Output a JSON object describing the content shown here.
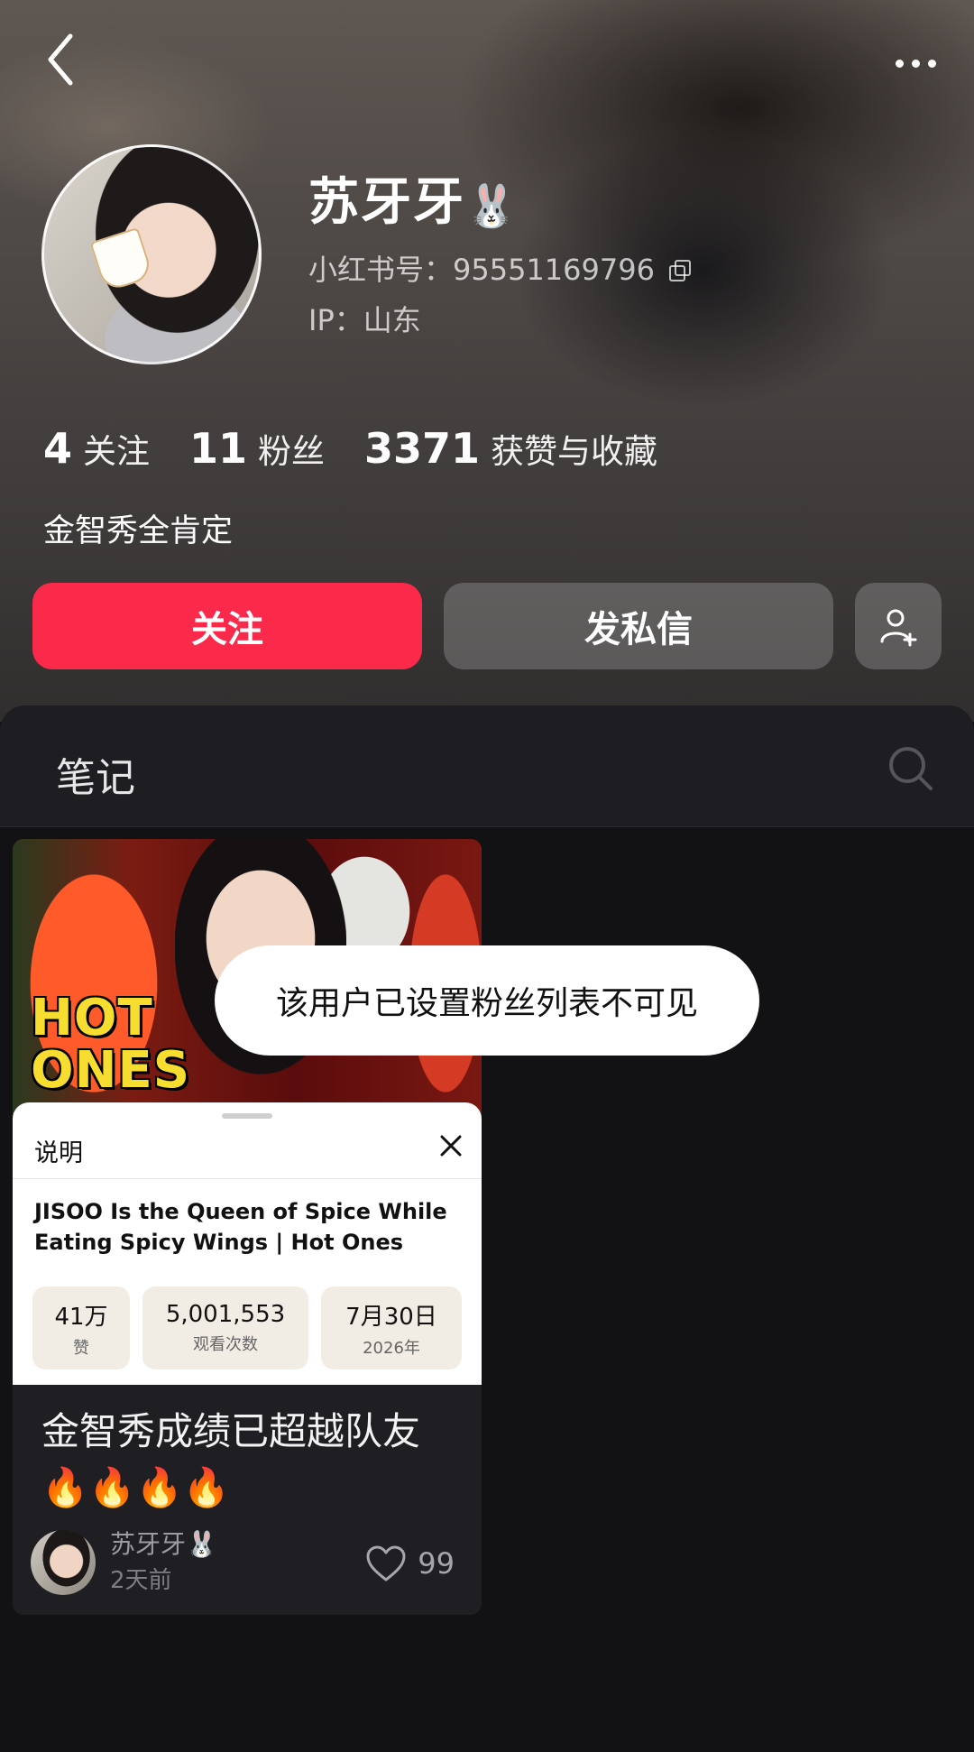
{
  "profile": {
    "name": "苏牙牙",
    "name_emoji": "🐰",
    "id_label": "小红书号：95551169796",
    "ip_label": "IP：山东",
    "bio": "金智秀全肯定"
  },
  "stats": [
    {
      "num": "4",
      "label": "关注"
    },
    {
      "num": "11",
      "label": "粉丝"
    },
    {
      "num": "3371",
      "label": "获赞与收藏"
    }
  ],
  "actions": {
    "follow": "关注",
    "message": "发私信"
  },
  "tabs": {
    "notes": "笔记"
  },
  "note": {
    "thumbnail_logo": {
      "line1": "HOT",
      "line2": "ONES"
    },
    "sheet": {
      "title": "说明",
      "video_title": "JISOO Is the Queen of Spice While Eating Spicy Wings | Hot Ones",
      "pills": [
        {
          "value": "41万",
          "label": "赞"
        },
        {
          "value": "5,001,553",
          "label": "观看次数"
        },
        {
          "value": "7月30日",
          "label": "2026年"
        }
      ]
    },
    "title": "金智秀成绩已超越队友🔥🔥🔥🔥",
    "author": "苏牙牙🐰",
    "time": "2天前",
    "likes": "99"
  },
  "toast": "该用户已设置粉丝列表不可见",
  "colors": {
    "accent": "#fb2a4a",
    "hot_ones_yellow": "#f6dd2f"
  }
}
